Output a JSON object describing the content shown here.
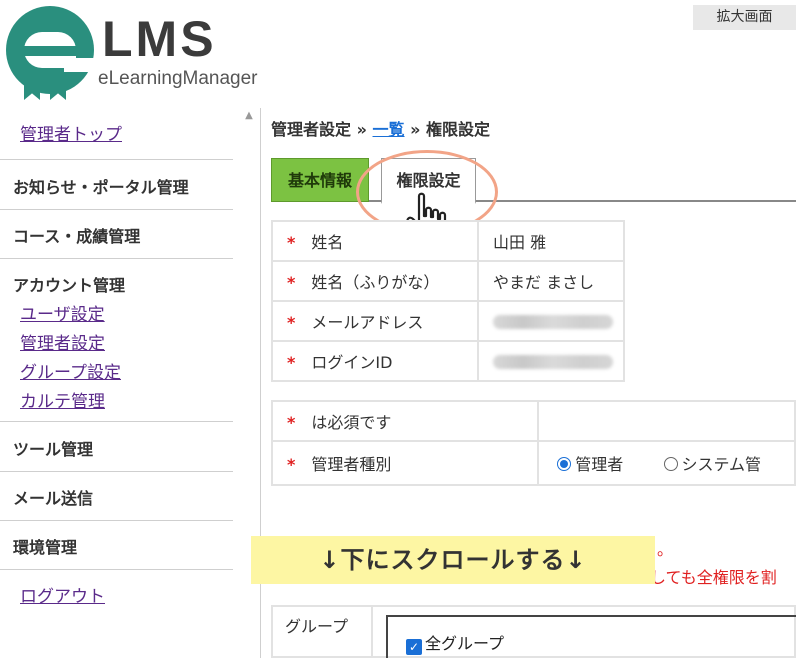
{
  "header": {
    "logo_title": "LMS",
    "logo_subtitle": "eLearningManager",
    "zoom_label": "拡大画面"
  },
  "sidebar": {
    "admin_top": "管理者トップ",
    "news_portal": "お知らせ・ポータル管理",
    "course_grades": "コース・成績管理",
    "account_mgmt": "アカウント管理",
    "account_links": [
      "ユーザ設定",
      "管理者設定",
      "グループ設定",
      "カルテ管理"
    ],
    "tool_mgmt": "ツール管理",
    "mail_send": "メール送信",
    "env_mgmt": "環境管理",
    "logout": "ログアウト"
  },
  "breadcrumb": {
    "root": "管理者設定",
    "sep": "»",
    "list_link": "一覧",
    "current": "権限設定"
  },
  "tabs": {
    "basic": "基本情報",
    "permission": "権限設定"
  },
  "profile_table": {
    "rows": [
      {
        "label": "姓名",
        "value": "山田 雅"
      },
      {
        "label": "姓名（ふりがな）",
        "value": "やまだ まさし"
      },
      {
        "label": "メールアドレス",
        "value": ""
      },
      {
        "label": "ログインID",
        "value": ""
      }
    ],
    "required_mark": "*"
  },
  "role_table": {
    "required_note": "は必須です",
    "role_label": "管理者種別",
    "option_admin": "管理者",
    "option_system": "システム管"
  },
  "notice": {
    "red_text": "しても全権限を割",
    "red_dots": "。"
  },
  "scroll_banner": "↓下にスクロールする↓",
  "group": {
    "label": "グループ",
    "all_groups": "全グループ",
    "check_mark": "✓"
  }
}
